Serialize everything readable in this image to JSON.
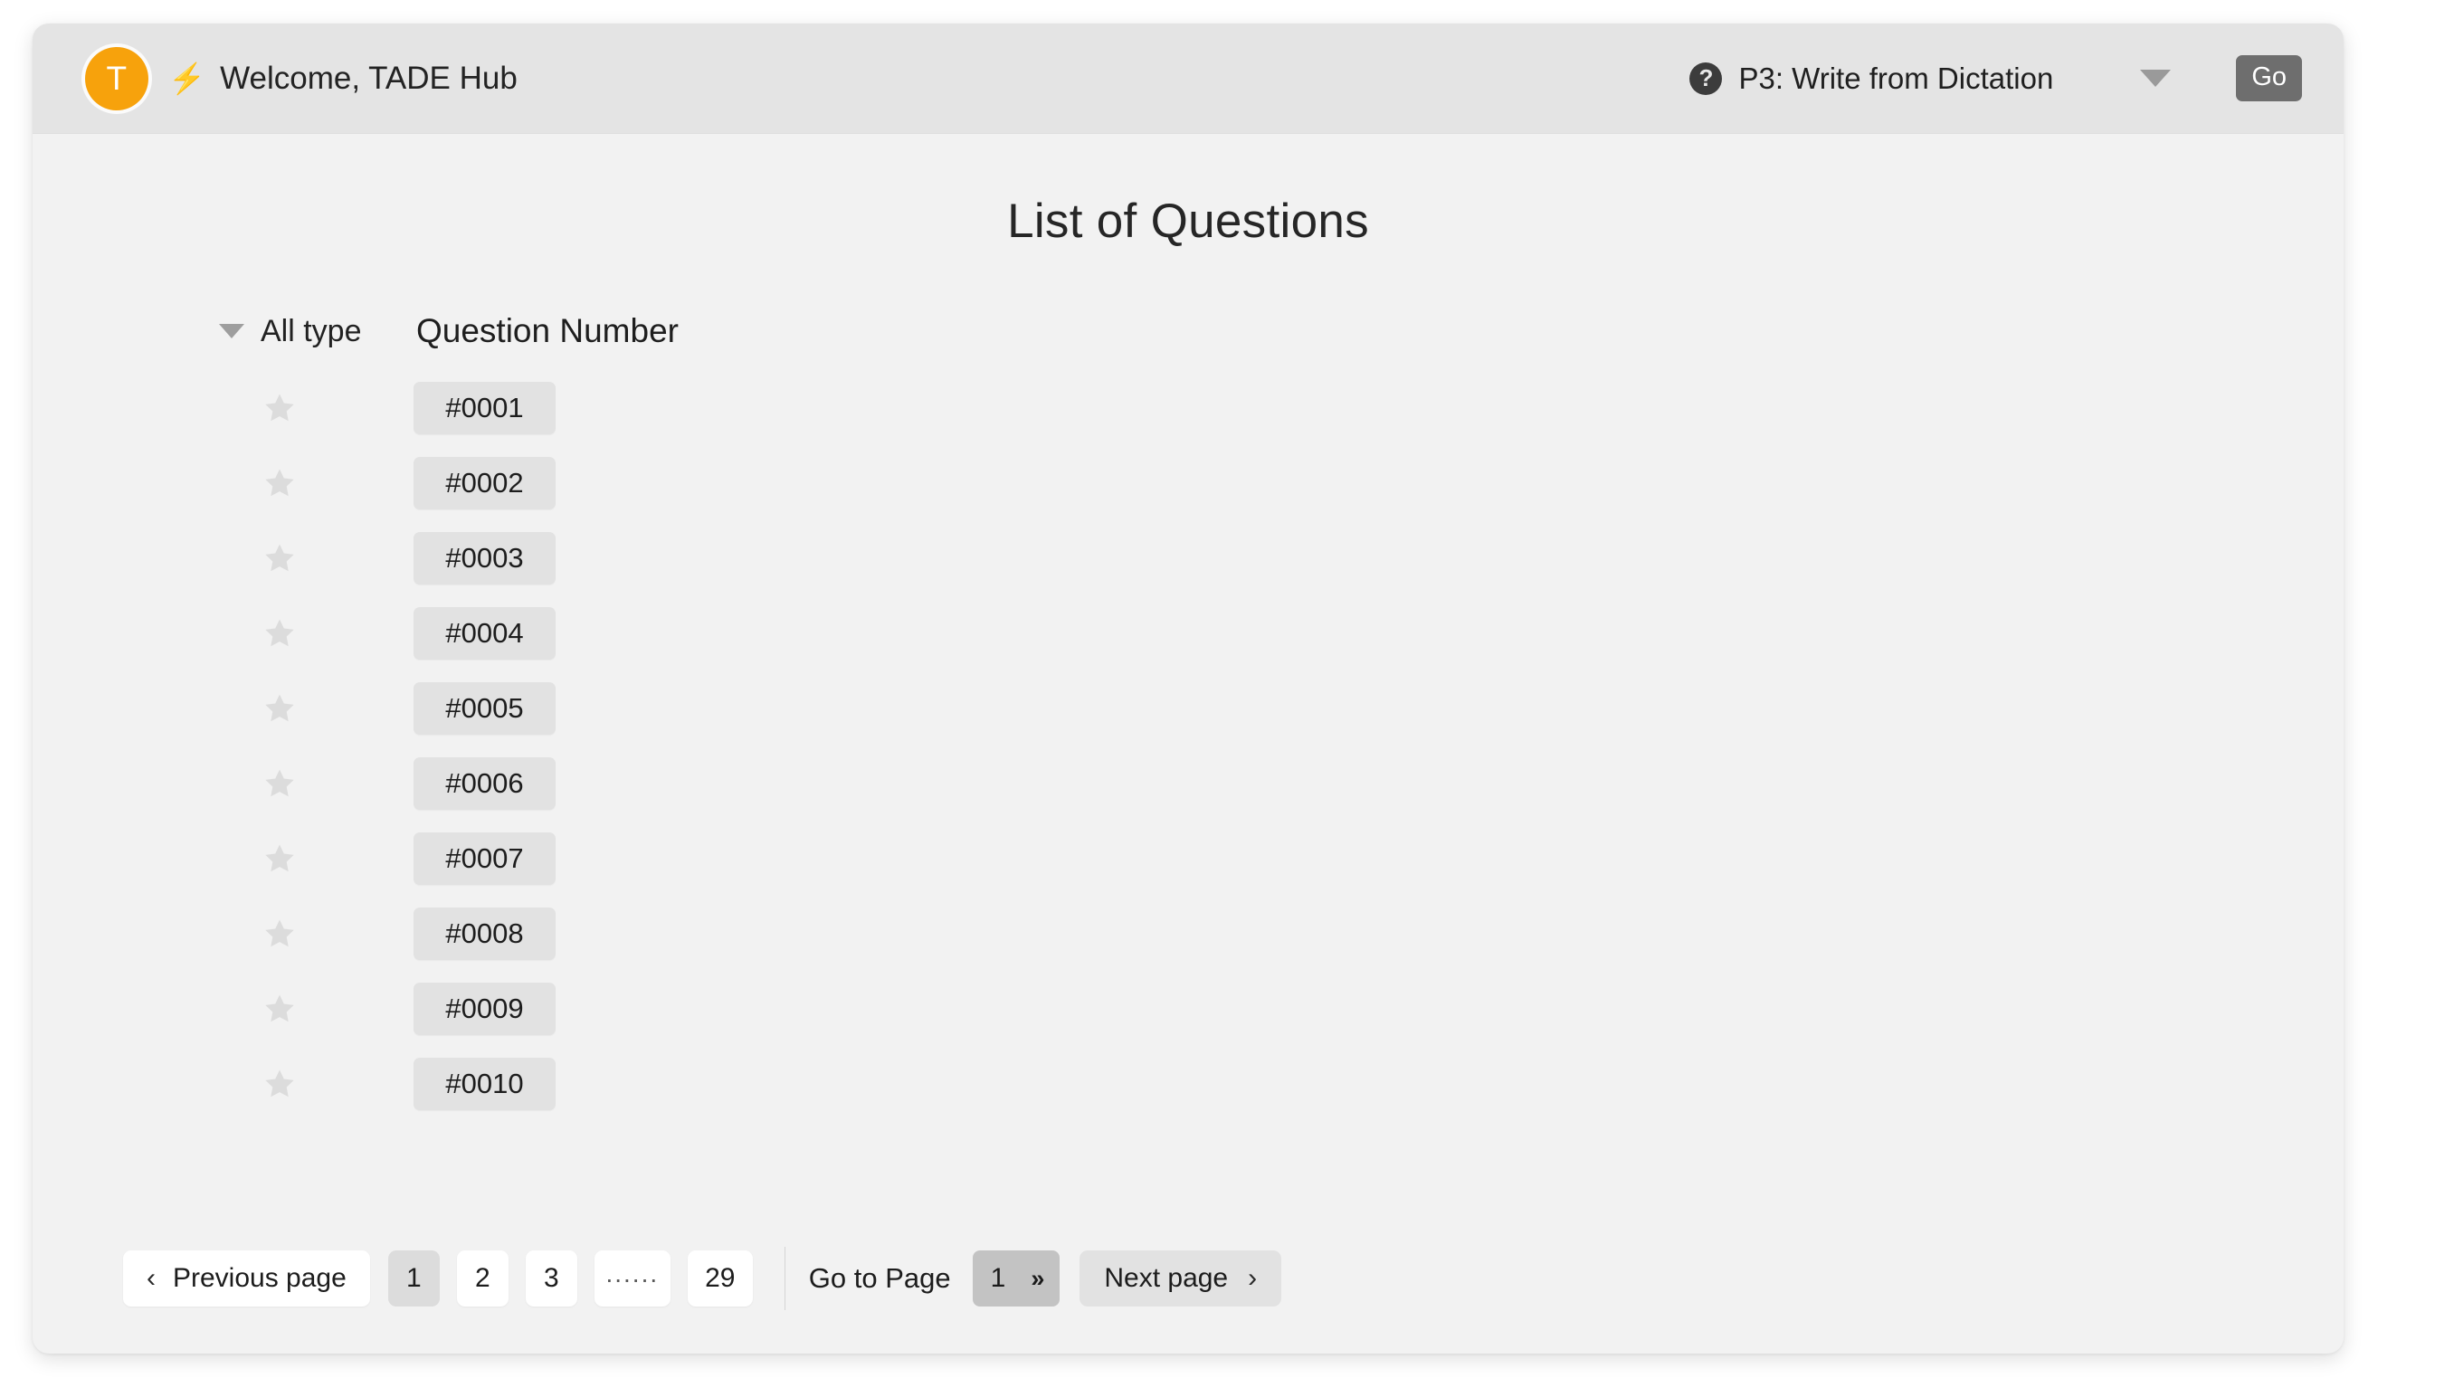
{
  "header": {
    "avatar_initial": "T",
    "bolt_icon": "bolt-icon",
    "welcome_text": "Welcome, TADE Hub",
    "help_icon": "?",
    "task_label": "P3: Write from Dictation",
    "caret_icon": "chevron-down-icon",
    "go_label": "Go",
    "accent_color": "#f7a20c",
    "bar_color": "#e4e4e4"
  },
  "main": {
    "title": "List of Questions",
    "filter_label": "All type",
    "column_header": "Question Number",
    "rows": [
      {
        "star": "star-icon",
        "number": "#0001"
      },
      {
        "star": "star-icon",
        "number": "#0002"
      },
      {
        "star": "star-icon",
        "number": "#0003"
      },
      {
        "star": "star-icon",
        "number": "#0004"
      },
      {
        "star": "star-icon",
        "number": "#0005"
      },
      {
        "star": "star-icon",
        "number": "#0006"
      },
      {
        "star": "star-icon",
        "number": "#0007"
      },
      {
        "star": "star-icon",
        "number": "#0008"
      },
      {
        "star": "star-icon",
        "number": "#0009"
      },
      {
        "star": "star-icon",
        "number": "#0010"
      }
    ]
  },
  "pagination": {
    "previous_label": "Previous page",
    "previous_chevron": "‹",
    "pages": [
      "1",
      "2",
      "3"
    ],
    "ellipsis": "......",
    "last_page": "29",
    "active_page": "1",
    "goto_label": "Go to Page",
    "goto_value": "1",
    "goto_arrows": "»",
    "next_label": "Next page",
    "next_chevron": "›"
  }
}
